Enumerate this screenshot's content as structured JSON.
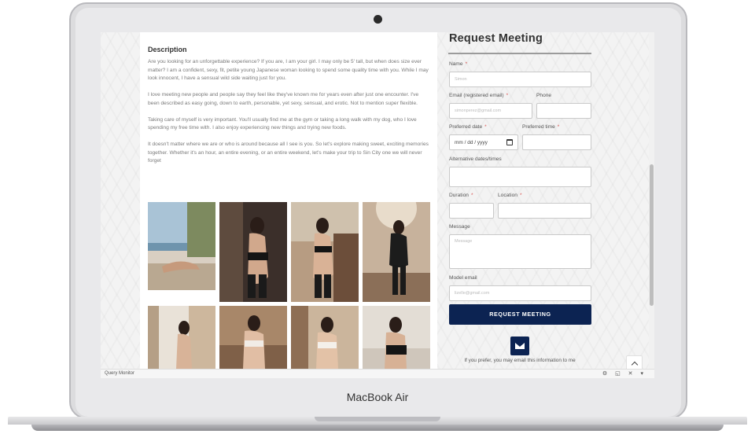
{
  "device": {
    "brand": "MacBook Air"
  },
  "description": {
    "title": "Description",
    "paragraphs": [
      "Are you looking for an unforgettable experience? If you are, I am your girl. I may only be 5' tall, but when does size ever matter? I am a confident, sexy, fit, petite young Japanese woman looking to spend some quality time with you. While I may look innocent, I have a sensual wild side waiting just for you.",
      "I love meeting new people and people say they feel like they've known me for years even after just one encounter. I've been described as easy going, down to earth, personable, yet sexy, sensual, and erotic. Not to mention super flexible.",
      "Taking care of myself is very important. You'll usually find me at the gym or taking a long walk with my dog, who I love spending my free time with. I also enjoy experiencing new things and trying new foods.",
      "It doesn't matter where we are or who is around because all I see is you. So let's explore making sweet, exciting memories together. Whether it's an hour, an entire evening, or an entire weekend, let's make your trip to Sin City one we will never forget"
    ]
  },
  "form": {
    "title": "Request Meeting",
    "labels": {
      "name": "Name",
      "email": "Email (registered email)",
      "phone": "Phone",
      "date": "Preferred date",
      "time": "Preferred time",
      "alt": "Alternative dates/times",
      "duration": "Duration",
      "location": "Location",
      "message": "Message",
      "model_email": "Model email"
    },
    "values": {
      "name": "Simon",
      "email": "simonperez@gmail.com",
      "date": "mm / dd / yyyy",
      "model_email": "lizelle@gmail.com"
    },
    "placeholders": {
      "message": "Message"
    },
    "submit_label": "REQUEST MEETING",
    "email_note": "If you prefer, you may email this information to me"
  },
  "footer": {
    "query_monitor": "Query Monitor",
    "icons": "⚙ ◱ ✕ ▾"
  },
  "colors": {
    "accent": "#0c2352",
    "required": "#d9534f"
  }
}
